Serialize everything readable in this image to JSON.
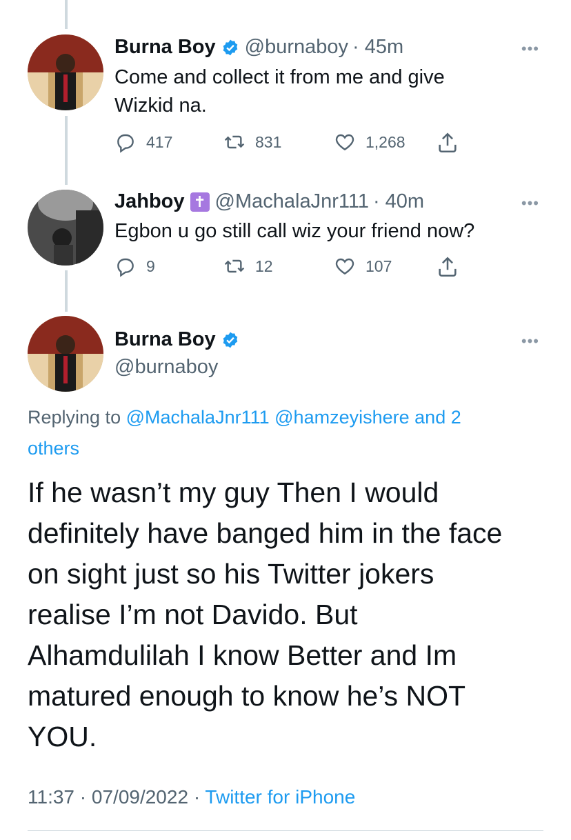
{
  "tweets": [
    {
      "name": "Burna Boy",
      "handle": "@burnaboy",
      "time": "· 45m",
      "text_lines": [
        "Come and collect it from me and give",
        "Wizkid na."
      ],
      "replies": "417",
      "retweets": "831",
      "likes": "1,268"
    },
    {
      "name": "Jahboy",
      "badge": "✝",
      "handle": "@MachalaJnr111",
      "time": "· 40m",
      "text": "Egbon u go still call wiz your friend now?",
      "replies": "9",
      "retweets": "12",
      "likes": "107"
    }
  ],
  "main": {
    "name": "Burna Boy",
    "handle": "@burnaboy",
    "replying_prefix": "Replying to",
    "mention1": "@MachalaJnr111",
    "mention2": "@hamzeyishere",
    "and_others_1": "and 2",
    "and_others_2": "others",
    "text_lines": [
      "If he wasn’t my guy Then I would",
      "definitely have banged him in the face",
      "on sight just so his Twitter jokers",
      "realise I’m not Davido. But",
      "Alhamdulilah I know Better and Im",
      "matured enough to know he’s NOT",
      "YOU."
    ],
    "time": "11:37",
    "date": "07/09/2022",
    "source": "Twitter for iPhone"
  },
  "more_label": "•••",
  "colors": {
    "accent": "#1d9bf0",
    "muted": "#536471",
    "thread": "#cfd9de"
  }
}
